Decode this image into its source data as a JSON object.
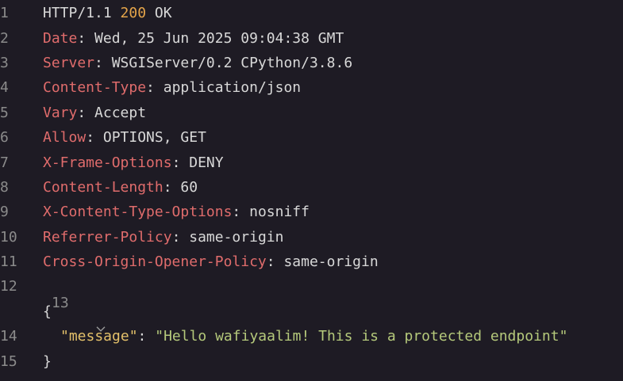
{
  "status_line": {
    "protocol": "HTTP/1.1",
    "code": "200",
    "reason": "OK"
  },
  "headers": [
    {
      "name": "Date",
      "value": "Wed, 25 Jun 2025 09:04:38 GMT"
    },
    {
      "name": "Server",
      "value": "WSGIServer/0.2 CPython/3.8.6"
    },
    {
      "name": "Content-Type",
      "value": "application/json"
    },
    {
      "name": "Vary",
      "value": "Accept"
    },
    {
      "name": "Allow",
      "value": "OPTIONS, GET"
    },
    {
      "name": "X-Frame-Options",
      "value": "DENY"
    },
    {
      "name": "Content-Length",
      "value": "60"
    },
    {
      "name": "X-Content-Type-Options",
      "value": "nosniff"
    },
    {
      "name": "Referrer-Policy",
      "value": "same-origin"
    },
    {
      "name": "Cross-Origin-Opener-Policy",
      "value": "same-origin"
    }
  ],
  "body": {
    "open_brace": "{",
    "close_brace": "}",
    "key": "\"message\"",
    "value": "\"Hello wafiyaalim! This is a protected endpoint\""
  },
  "line_numbers": [
    "1",
    "2",
    "3",
    "4",
    "5",
    "6",
    "7",
    "8",
    "9",
    "10",
    "11",
    "12",
    "13",
    "14",
    "15"
  ],
  "icons": {
    "fold": "chevron-down-icon"
  },
  "colors": {
    "background": "#1e1b24",
    "header_key": "#e06c6c",
    "status_code": "#e5a54a",
    "json_key": "#e3c06a",
    "json_string": "#b5c97b",
    "text": "#d8d8d8",
    "line_number": "#8b8b8b"
  }
}
